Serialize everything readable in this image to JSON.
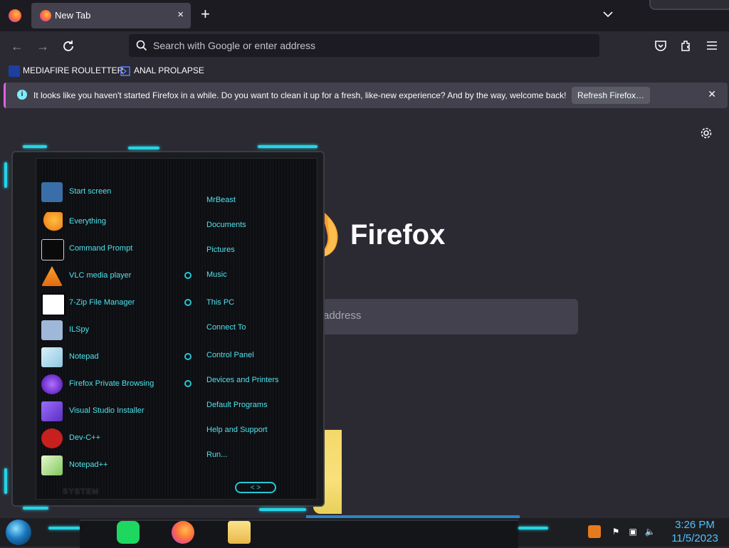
{
  "browser": {
    "tab": {
      "title": "New Tab",
      "close": "×"
    },
    "new_tab": "+",
    "address": {
      "placeholder": "Search with Google or enter address"
    },
    "bookmarks": [
      {
        "label": "MEDIAFIRE ROULETTER",
        "icon": "mf-badge-icon"
      },
      {
        "label": "ANAL PROLAPSE",
        "icon": "sigma-icon"
      }
    ],
    "notification": {
      "text": "It looks like you haven't started Firefox in a while. Do you want to clean it up for a fresh, like-new experience? And by the way, welcome back!",
      "button": "Refresh Firefox…",
      "info_glyph": "i",
      "close": "✕"
    },
    "home": {
      "brand": "Firefox",
      "search_placeholder_visible": "address"
    }
  },
  "start_menu": {
    "programs": [
      {
        "label": "Start screen",
        "icon": "start-screen-icon",
        "color": "#3a6ea8"
      },
      {
        "label": "Everything",
        "icon": "magnifier-icon",
        "color": "#f28a1e"
      },
      {
        "label": "Command Prompt",
        "icon": "cmd-icon",
        "color": "#0a0a0a"
      },
      {
        "label": "VLC media player",
        "icon": "vlc-cone-icon",
        "color": "#f28a1e"
      },
      {
        "label": "7-Zip File Manager",
        "icon": "7zip-icon",
        "color": "#000000"
      },
      {
        "label": "ILSpy",
        "icon": "ilspy-icon",
        "color": "#9fb7d8"
      },
      {
        "label": "Notepad",
        "icon": "notepad-icon",
        "color": "#9fd2e8"
      },
      {
        "label": "Firefox Private Browsing",
        "icon": "private-browsing-icon",
        "color": "#8b3fd9"
      },
      {
        "label": "Visual Studio Installer",
        "icon": "vs-installer-icon",
        "color": "#7b4fd6"
      },
      {
        "label": "Dev-C++",
        "icon": "devcpp-icon",
        "color": "#c8201e"
      },
      {
        "label": "Notepad++",
        "icon": "notepadpp-icon",
        "color": "#7ec85a"
      }
    ],
    "places": [
      {
        "label": "MrBeast",
        "arrow": false
      },
      {
        "label": "Documents",
        "arrow": false
      },
      {
        "label": "Pictures",
        "arrow": false
      },
      {
        "label": "Music",
        "arrow": true
      },
      {
        "label": "This PC",
        "arrow": true
      },
      {
        "label": "Connect To",
        "arrow": false
      },
      {
        "label": "Control Panel",
        "arrow": true
      },
      {
        "label": "Devices and Printers",
        "arrow": true
      },
      {
        "label": "Default Programs",
        "arrow": false
      },
      {
        "label": "Help and Support",
        "arrow": false
      },
      {
        "label": "Run...",
        "arrow": false
      }
    ],
    "system_label": "SYSTEM",
    "nav_arrows": "< >",
    "accent": "#24d4e6"
  },
  "taskbar": {
    "time": "3:26 PM",
    "date": "11/5/2023",
    "apps": [
      "notes-app-icon",
      "firefox-icon",
      "file-explorer-icon"
    ]
  }
}
